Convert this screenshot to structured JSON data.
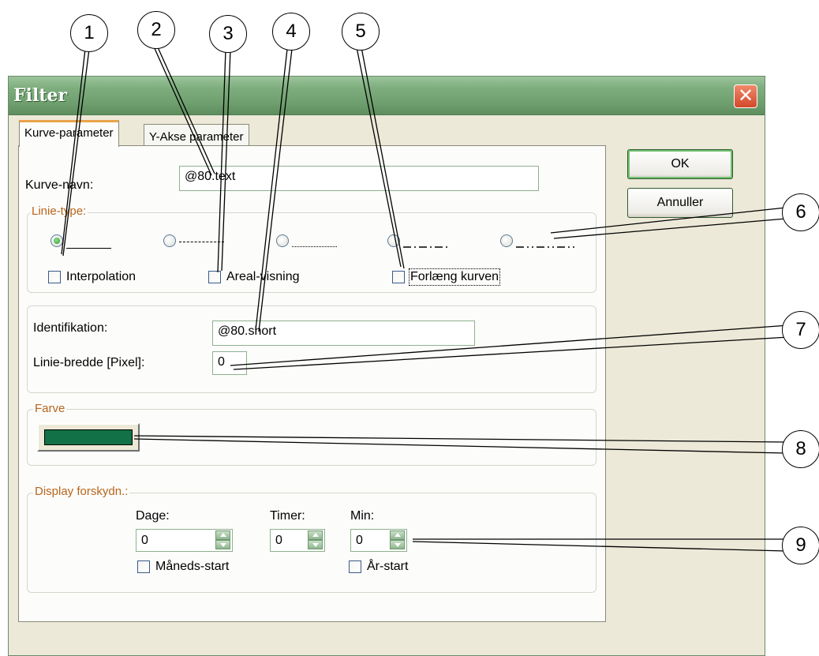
{
  "window": {
    "title": "Filter",
    "close_glyph": "✕"
  },
  "tabs": [
    {
      "label": "Kurve-parameter",
      "active": true
    },
    {
      "label": "Y-Akse parameter",
      "active": false
    }
  ],
  "curve_name": {
    "label": "Kurve-navn:",
    "value": "@80.text"
  },
  "line_type": {
    "legend": "Linie-type:",
    "options": [
      "solid",
      "dashed",
      "dotted",
      "dash-dot",
      "dash-dot-dot"
    ],
    "selected": 0
  },
  "checkboxes": {
    "interpolation": "Interpolation",
    "area_view": "Areal-visning",
    "extend_curve": "Forlæng kurven"
  },
  "identification": {
    "label": "Identifikation:",
    "value": "@80.short"
  },
  "line_width": {
    "label": "Linie-bredde [Pixel]:",
    "value": "0"
  },
  "color": {
    "legend": "Farve",
    "value": "#137147"
  },
  "display_offset": {
    "legend": "Display forskydn.:",
    "days": {
      "label": "Dage:",
      "value": "0"
    },
    "hours": {
      "label": "Timer:",
      "value": "0"
    },
    "minutes": {
      "label": "Min:",
      "value": "0"
    },
    "month_start": "Måneds-start",
    "year_start": "År-start"
  },
  "buttons": {
    "ok": "OK",
    "cancel": "Annuller"
  },
  "callouts": [
    "1",
    "2",
    "3",
    "4",
    "5",
    "6",
    "7",
    "8",
    "9"
  ]
}
